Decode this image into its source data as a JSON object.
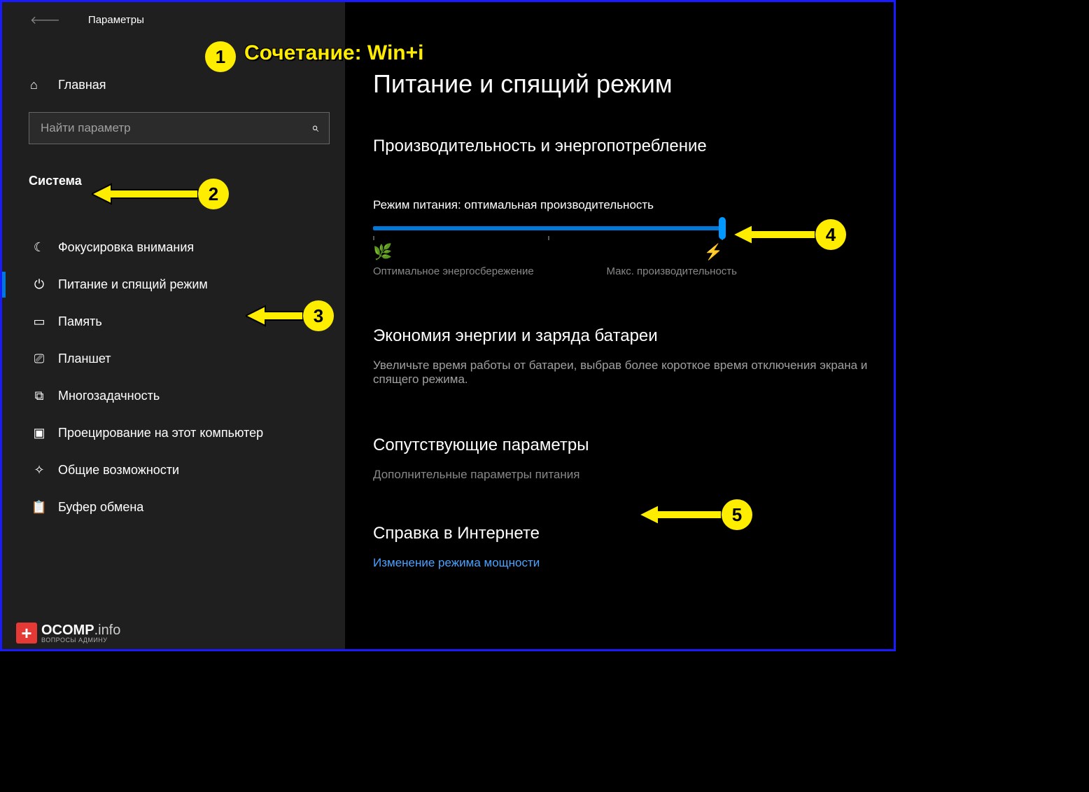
{
  "app_title": "Параметры",
  "home_label": "Главная",
  "search": {
    "placeholder": "Найти параметр"
  },
  "category": "Система",
  "nav": [
    {
      "label": "Фокусировка внимания",
      "icon": "☾"
    },
    {
      "label": "Питание и спящий режим",
      "icon": "⏻"
    },
    {
      "label": "Память",
      "icon": "▭"
    },
    {
      "label": "Планшет",
      "icon": "⎚"
    },
    {
      "label": "Многозадачность",
      "icon": "⧉"
    },
    {
      "label": "Проецирование на этот компьютер",
      "icon": "▣"
    },
    {
      "label": "Общие возможности",
      "icon": "✧"
    },
    {
      "label": "Буфер обмена",
      "icon": "📋"
    }
  ],
  "page": {
    "title": "Питание и спящий режим",
    "perf_heading": "Производительность и энергопотребление",
    "mode_label": "Режим питания: оптимальная производительность",
    "slider_left": "Оптимальное энергосбережение",
    "slider_right": "Макс. производительность",
    "eco_heading": "Экономия энергии и заряда батареи",
    "eco_desc": "Увеличьте время работы от батареи, выбрав более короткое время отключения экрана и спящего режима.",
    "related_heading": "Сопутствующие параметры",
    "related_link": "Дополнительные параметры питания",
    "help_heading": "Справка в Интернете",
    "help_link": "Изменение режима мощности"
  },
  "annotations": {
    "a1_text": "Сочетание: Win+i",
    "n1": "1",
    "n2": "2",
    "n3": "3",
    "n4": "4",
    "n5": "5"
  },
  "watermark": {
    "line1a": "OCOMP",
    "line1b": ".info",
    "line2": "ВОПРОСЫ АДМИНУ"
  }
}
